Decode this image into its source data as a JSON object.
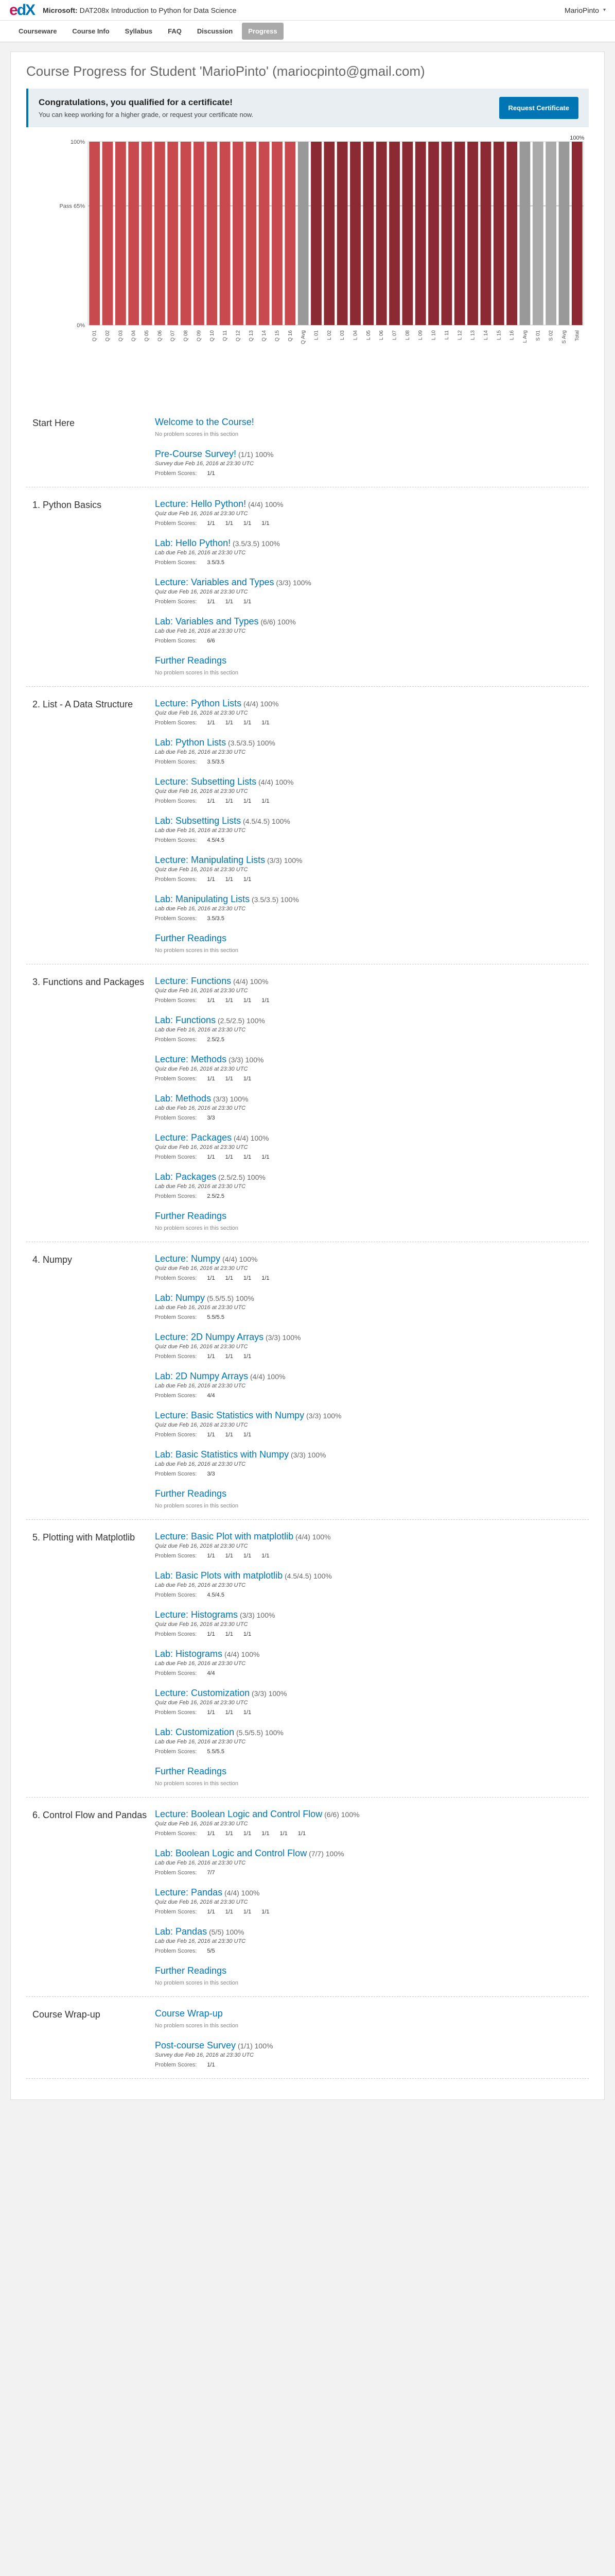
{
  "header": {
    "logo_e": "e",
    "logo_dx": "dX",
    "course_prefix": "Microsoft:",
    "course_name": "DAT208x Introduction to Python for Data Science",
    "username": "MarioPinto",
    "menu_arrow": "▾"
  },
  "nav": [
    "Courseware",
    "Course Info",
    "Syllabus",
    "FAQ",
    "Discussion",
    "Progress"
  ],
  "page_title": "Course Progress for Student 'MarioPinto' (mariocpinto@gmail.com)",
  "certificate": {
    "heading": "Congratulations, you qualified for a certificate!",
    "text": "You can keep working for a higher grade, or request your certificate now.",
    "button": "Request Certificate"
  },
  "chart_data": {
    "type": "bar",
    "ylim": [
      0,
      100
    ],
    "yticks": [
      "0%",
      "Pass 65%",
      "100%"
    ],
    "pass_line": 65,
    "total_label": "100%",
    "colors": {
      "quiz": "#c84a4f",
      "lab": "#8b2a33",
      "avg": "#999999",
      "survey": "#aaaaaa",
      "total": "#8b2a33"
    },
    "categories": [
      "Q 01",
      "Q 02",
      "Q 03",
      "Q 04",
      "Q 05",
      "Q 06",
      "Q 07",
      "Q 08",
      "Q 09",
      "Q 10",
      "Q 11",
      "Q 12",
      "Q 13",
      "Q 14",
      "Q 15",
      "Q 16",
      "Q Avg",
      "L 01",
      "L 02",
      "L 03",
      "L 04",
      "L 05",
      "L 06",
      "L 07",
      "L 08",
      "L 09",
      "L 10",
      "L 11",
      "L 12",
      "L 13",
      "L 14",
      "L 15",
      "L 16",
      "L Avg",
      "S 01",
      "S 02",
      "S Avg",
      "Total"
    ],
    "groups": [
      "quiz",
      "quiz",
      "quiz",
      "quiz",
      "quiz",
      "quiz",
      "quiz",
      "quiz",
      "quiz",
      "quiz",
      "quiz",
      "quiz",
      "quiz",
      "quiz",
      "quiz",
      "quiz",
      "avg",
      "lab",
      "lab",
      "lab",
      "lab",
      "lab",
      "lab",
      "lab",
      "lab",
      "lab",
      "lab",
      "lab",
      "lab",
      "lab",
      "lab",
      "lab",
      "lab",
      "avg",
      "survey",
      "survey",
      "avg",
      "total"
    ],
    "values": [
      100,
      100,
      100,
      100,
      100,
      100,
      100,
      100,
      100,
      100,
      100,
      100,
      100,
      100,
      100,
      100,
      100,
      100,
      100,
      100,
      100,
      100,
      100,
      100,
      100,
      100,
      100,
      100,
      100,
      100,
      100,
      100,
      100,
      100,
      100,
      100,
      100,
      100
    ]
  },
  "sections": [
    {
      "title": "Start Here",
      "items": [
        {
          "link": "Welcome to the Course!",
          "score": "",
          "due": "",
          "none": "No problem scores in this section"
        },
        {
          "link": "Pre-Course Survey!",
          "score": "(1/1) 100%",
          "due": "Survey due Feb 16, 2016 at 23:30 UTC",
          "label": "Problem Scores:",
          "scores": [
            "1/1"
          ]
        }
      ]
    },
    {
      "title": "1. Python Basics",
      "items": [
        {
          "link": "Lecture: Hello Python!",
          "score": "(4/4) 100%",
          "due": "Quiz due Feb 16, 2016 at 23:30 UTC",
          "label": "Problem Scores:",
          "scores": [
            "1/1",
            "1/1",
            "1/1",
            "1/1"
          ]
        },
        {
          "link": "Lab: Hello Python!",
          "score": "(3.5/3.5) 100%",
          "due": "Lab due Feb 16, 2016 at 23:30 UTC",
          "label": "Problem Scores:",
          "scores": [
            "3.5/3.5"
          ]
        },
        {
          "link": "Lecture: Variables and Types",
          "score": "(3/3) 100%",
          "due": "Quiz due Feb 16, 2016 at 23:30 UTC",
          "label": "Problem Scores:",
          "scores": [
            "1/1",
            "1/1",
            "1/1"
          ]
        },
        {
          "link": "Lab: Variables and Types",
          "score": "(6/6) 100%",
          "due": "Lab due Feb 16, 2016 at 23:30 UTC",
          "label": "Problem Scores:",
          "scores": [
            "6/6"
          ]
        },
        {
          "link": "Further Readings",
          "score": "",
          "due": "",
          "none": "No problem scores in this section"
        }
      ]
    },
    {
      "title": "2. List - A Data Structure",
      "items": [
        {
          "link": "Lecture: Python Lists",
          "score": "(4/4) 100%",
          "due": "Quiz due Feb 16, 2016 at 23:30 UTC",
          "label": "Problem Scores:",
          "scores": [
            "1/1",
            "1/1",
            "1/1",
            "1/1"
          ]
        },
        {
          "link": "Lab: Python Lists",
          "score": "(3.5/3.5) 100%",
          "due": "Lab due Feb 16, 2016 at 23:30 UTC",
          "label": "Problem Scores:",
          "scores": [
            "3.5/3.5"
          ]
        },
        {
          "link": "Lecture: Subsetting Lists",
          "score": "(4/4) 100%",
          "due": "Quiz due Feb 16, 2016 at 23:30 UTC",
          "label": "Problem Scores:",
          "scores": [
            "1/1",
            "1/1",
            "1/1",
            "1/1"
          ]
        },
        {
          "link": "Lab: Subsetting Lists",
          "score": "(4.5/4.5) 100%",
          "due": "Lab due Feb 16, 2016 at 23:30 UTC",
          "label": "Problem Scores:",
          "scores": [
            "4.5/4.5"
          ]
        },
        {
          "link": "Lecture: Manipulating Lists",
          "score": "(3/3) 100%",
          "due": "Quiz due Feb 16, 2016 at 23:30 UTC",
          "label": "Problem Scores:",
          "scores": [
            "1/1",
            "1/1",
            "1/1"
          ]
        },
        {
          "link": "Lab: Manipulating Lists",
          "score": "(3.5/3.5) 100%",
          "due": "Lab due Feb 16, 2016 at 23:30 UTC",
          "label": "Problem Scores:",
          "scores": [
            "3.5/3.5"
          ]
        },
        {
          "link": "Further Readings",
          "score": "",
          "due": "",
          "none": "No problem scores in this section"
        }
      ]
    },
    {
      "title": "3. Functions and Packages",
      "items": [
        {
          "link": "Lecture: Functions",
          "score": "(4/4) 100%",
          "due": "Quiz due Feb 16, 2016 at 23:30 UTC",
          "label": "Problem Scores:",
          "scores": [
            "1/1",
            "1/1",
            "1/1",
            "1/1"
          ]
        },
        {
          "link": "Lab: Functions",
          "score": "(2.5/2.5) 100%",
          "due": "Lab due Feb 16, 2016 at 23:30 UTC",
          "label": "Problem Scores:",
          "scores": [
            "2.5/2.5"
          ]
        },
        {
          "link": "Lecture: Methods",
          "score": "(3/3) 100%",
          "due": "Quiz due Feb 16, 2016 at 23:30 UTC",
          "label": "Problem Scores:",
          "scores": [
            "1/1",
            "1/1",
            "1/1"
          ]
        },
        {
          "link": "Lab: Methods",
          "score": "(3/3) 100%",
          "due": "Lab due Feb 16, 2016 at 23:30 UTC",
          "label": "Problem Scores:",
          "scores": [
            "3/3"
          ]
        },
        {
          "link": "Lecture: Packages",
          "score": "(4/4) 100%",
          "due": "Quiz due Feb 16, 2016 at 23:30 UTC",
          "label": "Problem Scores:",
          "scores": [
            "1/1",
            "1/1",
            "1/1",
            "1/1"
          ]
        },
        {
          "link": "Lab: Packages",
          "score": "(2.5/2.5) 100%",
          "due": "Lab due Feb 16, 2016 at 23:30 UTC",
          "label": "Problem Scores:",
          "scores": [
            "2.5/2.5"
          ]
        },
        {
          "link": "Further Readings",
          "score": "",
          "due": "",
          "none": "No problem scores in this section"
        }
      ]
    },
    {
      "title": "4. Numpy",
      "items": [
        {
          "link": "Lecture: Numpy",
          "score": "(4/4) 100%",
          "due": "Quiz due Feb 16, 2016 at 23:30 UTC",
          "label": "Problem Scores:",
          "scores": [
            "1/1",
            "1/1",
            "1/1",
            "1/1"
          ]
        },
        {
          "link": "Lab: Numpy",
          "score": "(5.5/5.5) 100%",
          "due": "Lab due Feb 16, 2016 at 23:30 UTC",
          "label": "Problem Scores:",
          "scores": [
            "5.5/5.5"
          ]
        },
        {
          "link": "Lecture: 2D Numpy Arrays",
          "score": "(3/3) 100%",
          "due": "Quiz due Feb 16, 2016 at 23:30 UTC",
          "label": "Problem Scores:",
          "scores": [
            "1/1",
            "1/1",
            "1/1"
          ]
        },
        {
          "link": "Lab: 2D Numpy Arrays",
          "score": "(4/4) 100%",
          "due": "Lab due Feb 16, 2016 at 23:30 UTC",
          "label": "Problem Scores:",
          "scores": [
            "4/4"
          ]
        },
        {
          "link": "Lecture: Basic Statistics with Numpy",
          "score": "(3/3) 100%",
          "due": "Quiz due Feb 16, 2016 at 23:30 UTC",
          "label": "Problem Scores:",
          "scores": [
            "1/1",
            "1/1",
            "1/1"
          ]
        },
        {
          "link": "Lab: Basic Statistics with Numpy",
          "score": "(3/3) 100%",
          "due": "Lab due Feb 16, 2016 at 23:30 UTC",
          "label": "Problem Scores:",
          "scores": [
            "3/3"
          ]
        },
        {
          "link": "Further Readings",
          "score": "",
          "due": "",
          "none": "No problem scores in this section"
        }
      ]
    },
    {
      "title": "5. Plotting with Matplotlib",
      "items": [
        {
          "link": "Lecture: Basic Plot with matplotlib",
          "score": "(4/4) 100%",
          "due": "Quiz due Feb 16, 2016 at 23:30 UTC",
          "label": "Problem Scores:",
          "scores": [
            "1/1",
            "1/1",
            "1/1",
            "1/1"
          ]
        },
        {
          "link": "Lab: Basic Plots with matplotlib",
          "score": "(4.5/4.5) 100%",
          "due": "Lab due Feb 16, 2016 at 23:30 UTC",
          "label": "Problem Scores:",
          "scores": [
            "4.5/4.5"
          ]
        },
        {
          "link": "Lecture: Histograms",
          "score": "(3/3) 100%",
          "due": "Quiz due Feb 16, 2016 at 23:30 UTC",
          "label": "Problem Scores:",
          "scores": [
            "1/1",
            "1/1",
            "1/1"
          ]
        },
        {
          "link": "Lab: Histograms",
          "score": "(4/4) 100%",
          "due": "Lab due Feb 16, 2016 at 23:30 UTC",
          "label": "Problem Scores:",
          "scores": [
            "4/4"
          ]
        },
        {
          "link": "Lecture: Customization",
          "score": "(3/3) 100%",
          "due": "Quiz due Feb 16, 2016 at 23:30 UTC",
          "label": "Problem Scores:",
          "scores": [
            "1/1",
            "1/1",
            "1/1"
          ]
        },
        {
          "link": "Lab: Customization",
          "score": "(5.5/5.5) 100%",
          "due": "Lab due Feb 16, 2016 at 23:30 UTC",
          "label": "Problem Scores:",
          "scores": [
            "5.5/5.5"
          ]
        },
        {
          "link": "Further Readings",
          "score": "",
          "due": "",
          "none": "No problem scores in this section"
        }
      ]
    },
    {
      "title": "6. Control Flow and Pandas",
      "items": [
        {
          "link": "Lecture: Boolean Logic and Control Flow",
          "score": "(6/6) 100%",
          "due": "Quiz due Feb 16, 2016 at 23:30 UTC",
          "label": "Problem Scores:",
          "scores": [
            "1/1",
            "1/1",
            "1/1",
            "1/1",
            "1/1",
            "1/1"
          ]
        },
        {
          "link": "Lab: Boolean Logic and Control Flow",
          "score": "(7/7) 100%",
          "due": "Lab due Feb 16, 2016 at 23:30 UTC",
          "label": "Problem Scores:",
          "scores": [
            "7/7"
          ]
        },
        {
          "link": "Lecture: Pandas",
          "score": "(4/4) 100%",
          "due": "Quiz due Feb 16, 2016 at 23:30 UTC",
          "label": "Problem Scores:",
          "scores": [
            "1/1",
            "1/1",
            "1/1",
            "1/1"
          ]
        },
        {
          "link": "Lab: Pandas",
          "score": "(5/5) 100%",
          "due": "Lab due Feb 16, 2016 at 23:30 UTC",
          "label": "Problem Scores:",
          "scores": [
            "5/5"
          ]
        },
        {
          "link": "Further Readings",
          "score": "",
          "due": "",
          "none": "No problem scores in this section"
        }
      ]
    },
    {
      "title": "Course Wrap-up",
      "items": [
        {
          "link": "Course Wrap-up",
          "score": "",
          "due": "",
          "none": "No problem scores in this section"
        },
        {
          "link": "Post-course Survey",
          "score": "(1/1) 100%",
          "due": "Survey due Feb 16, 2016 at 23:30 UTC",
          "label": "Problem Scores:",
          "scores": [
            "1/1"
          ]
        }
      ]
    }
  ]
}
